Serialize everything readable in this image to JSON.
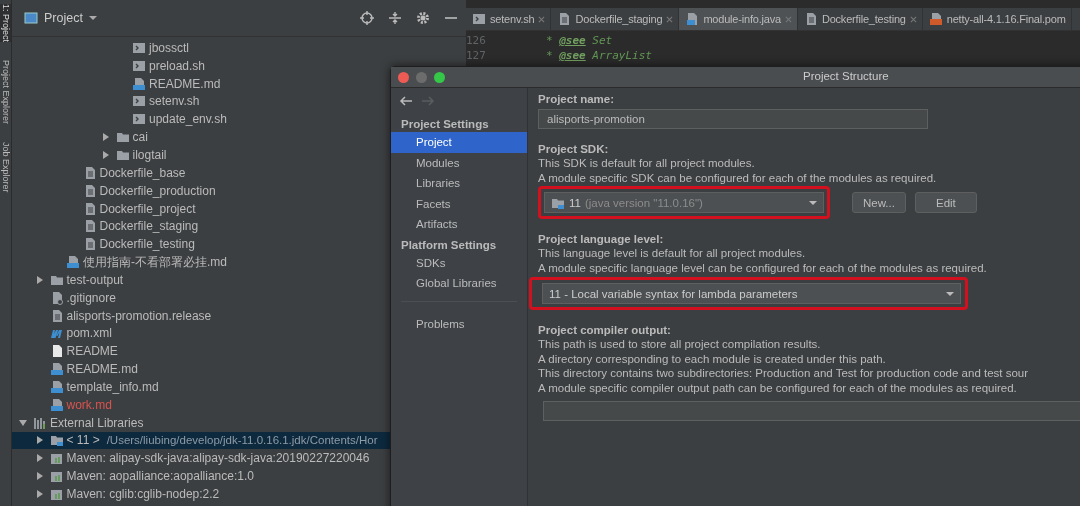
{
  "tool_strip": [
    {
      "label": "1: Project",
      "selected": true
    },
    {
      "label": "Project Explorer",
      "selected": false
    },
    {
      "label": "Job Explorer",
      "selected": false
    }
  ],
  "project_panel": {
    "title": "Project",
    "tree": [
      {
        "children": [
          {
            "children": [
              {
                "children": [
                  {
                    "children": [
                      {
                        "children": [
                          {
                            "children": [
                              {
                                "label": "jbossctl",
                                "kind": "sh",
                                "selected": false
                              },
                              {
                                "label": "preload.sh",
                                "kind": "sh",
                                "selected": false
                              },
                              {
                                "label": "README.md",
                                "kind": "md",
                                "selected": false
                              },
                              {
                                "label": "setenv.sh",
                                "kind": "sh",
                                "selected": false
                              },
                              {
                                "label": "update_env.sh",
                                "kind": "sh",
                                "selected": false
                              }
                            ]
                          },
                          {
                            "label": "cai",
                            "kind": "folder",
                            "expanded": false,
                            "selected": false
                          },
                          {
                            "label": "ilogtail",
                            "kind": "folder",
                            "expanded": false,
                            "selected": false
                          }
                        ]
                      }
                    ]
                  },
                  {
                    "label": "Dockerfile_base",
                    "kind": "text",
                    "selected": false
                  },
                  {
                    "label": "Dockerfile_production",
                    "kind": "text",
                    "selected": false
                  },
                  {
                    "label": "Dockerfile_project",
                    "kind": "text",
                    "selected": false
                  },
                  {
                    "label": "Dockerfile_staging",
                    "kind": "text",
                    "selected": false
                  },
                  {
                    "label": "Dockerfile_testing",
                    "kind": "text",
                    "selected": false
                  }
                ]
              },
              {
                "label": "使用指南-不看部署必挂.md",
                "kind": "md",
                "selected": false
              }
            ]
          },
          {
            "label": "test-output",
            "kind": "folder",
            "expanded": false,
            "selected": false
          },
          {
            "label": ".gitignore",
            "kind": "ignore",
            "selected": false
          },
          {
            "label": "alisports-promotion.release",
            "kind": "text",
            "selected": false
          },
          {
            "label": "pom.xml",
            "kind": "maven",
            "selected": false
          },
          {
            "label": "README",
            "kind": "blank",
            "selected": false
          },
          {
            "label": "README.md",
            "kind": "md",
            "selected": false
          },
          {
            "label": "template_info.md",
            "kind": "md",
            "selected": false
          },
          {
            "label": "work.md",
            "kind": "md",
            "selected": false,
            "color": "#d9534f"
          }
        ]
      },
      {
        "label": "External Libraries",
        "kind": "libraries",
        "expanded": true,
        "selected": false,
        "children": [
          {
            "label": "< 11 >",
            "detail": "/Users/liubing/develop/jdk-11.0.16.1.jdk/Contents/Hor",
            "kind": "jdk",
            "expanded": false,
            "selected": true
          },
          {
            "label": "Maven: alipay-sdk-java:alipay-sdk-java:20190227220046",
            "kind": "library",
            "expanded": false,
            "selected": false
          },
          {
            "label": "Maven: aopalliance:aopalliance:1.0",
            "kind": "library",
            "expanded": false,
            "selected": false
          },
          {
            "label": "Maven: cglib:cglib-nodep:2.2",
            "kind": "library",
            "expanded": false,
            "selected": false
          }
        ]
      }
    ]
  },
  "editor": {
    "tabs": [
      {
        "label": "setenv.sh",
        "kind": "sh",
        "selected": false,
        "closable": true
      },
      {
        "label": "Dockerfile_staging",
        "kind": "text",
        "selected": false,
        "closable": true
      },
      {
        "label": "module-info.java",
        "kind": "java",
        "selected": true,
        "closable": true
      },
      {
        "label": "Dockerfile_testing",
        "kind": "text",
        "selected": false,
        "closable": true
      },
      {
        "label": "netty-all-4.1.16.Final.pom",
        "kind": "pom",
        "selected": false,
        "closable": false
      }
    ],
    "lines": [
      {
        "number": "126",
        "prefix": "*",
        "tag": "@see",
        "text": "Set"
      },
      {
        "number": "127",
        "prefix": "*",
        "tag": "@see",
        "text": "ArrayList"
      }
    ]
  },
  "dialog": {
    "title": "Project Structure",
    "nav": [
      {
        "kind": "back",
        "disabled": false
      },
      {
        "kind": "forward",
        "disabled": true
      }
    ],
    "sections": [
      {
        "title": "Project Settings",
        "items": [
          {
            "label": "Project",
            "selected": true
          },
          {
            "label": "Modules",
            "selected": false
          },
          {
            "label": "Libraries",
            "selected": false
          },
          {
            "label": "Facets",
            "selected": false
          },
          {
            "label": "Artifacts",
            "selected": false
          }
        ]
      },
      {
        "title": "Platform Settings",
        "items": [
          {
            "label": "SDKs",
            "selected": false
          },
          {
            "label": "Global Libraries",
            "selected": false
          }
        ]
      },
      {
        "items": [
          {
            "label": "Problems",
            "selected": false
          }
        ]
      }
    ],
    "project_name": {
      "label": "Project name:",
      "value": "alisports-promotion"
    },
    "sdk": {
      "label": "Project SDK:",
      "notes": [
        "This SDK is default for all project modules.",
        "A module specific SDK can be configured for each of the modules as required."
      ],
      "value": "11",
      "detail": "(java version \"11.0.16\")",
      "highlighted": true,
      "buttons": [
        "New...",
        "Edit"
      ]
    },
    "language_level": {
      "label": "Project language level:",
      "notes": [
        "This language level is default for all project modules.",
        "A module specific language level can be configured for each of the modules as required."
      ],
      "value": "11 - Local variable syntax for lambda parameters",
      "highlighted": true
    },
    "compiler_output": {
      "label": "Project compiler output:",
      "notes": [
        "This path is used to store all project compilation results.",
        "A directory corresponding to each module is created under this path.",
        "This directory contains two subdirectories: Production and Test for production code and test sour",
        "A module specific compiler output path can be configured for each of the modules as required."
      ]
    }
  }
}
